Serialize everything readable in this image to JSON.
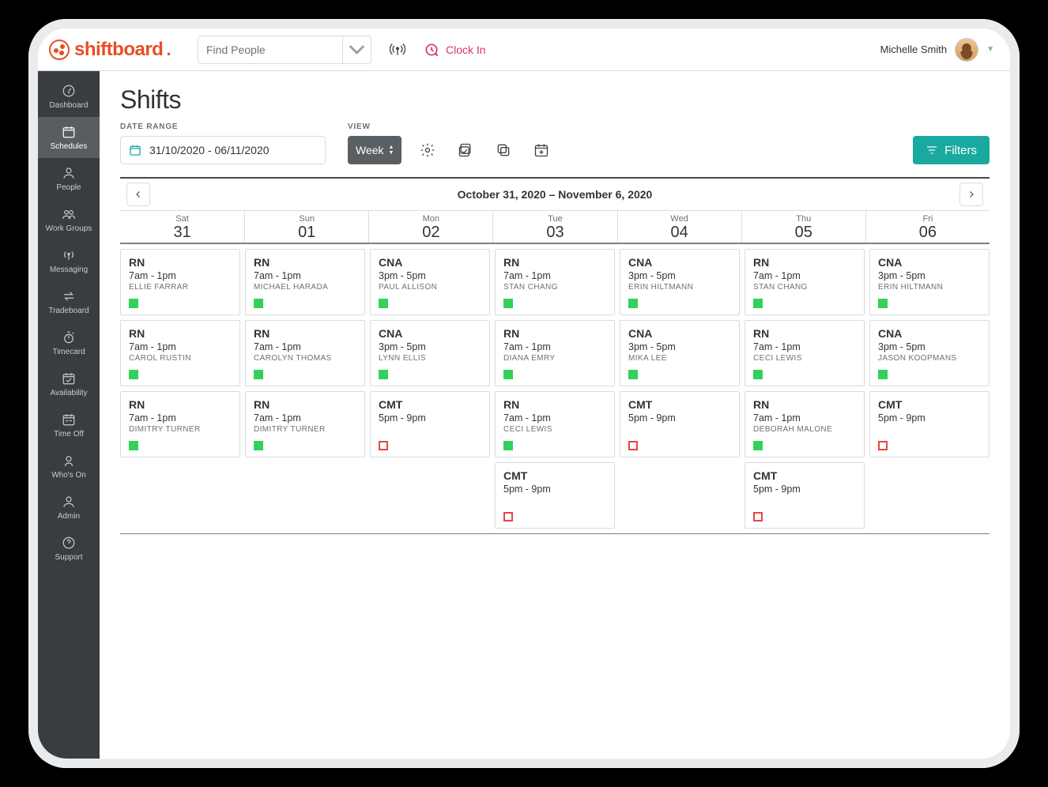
{
  "brand": "shiftboard",
  "find": {
    "selected": "Find People"
  },
  "clock_in": "Clock In",
  "user": {
    "name": "Michelle Smith"
  },
  "sidebar": {
    "items": [
      {
        "label": "Dashboard",
        "icon": "gauge"
      },
      {
        "label": "Schedules",
        "icon": "calendar",
        "active": true
      },
      {
        "label": "People",
        "icon": "person"
      },
      {
        "label": "Work Groups",
        "icon": "people"
      },
      {
        "label": "Messaging",
        "icon": "antenna"
      },
      {
        "label": "Tradeboard",
        "icon": "swap"
      },
      {
        "label": "Timecard",
        "icon": "stopwatch"
      },
      {
        "label": "Availability",
        "icon": "cal-check"
      },
      {
        "label": "Time Off",
        "icon": "cal-range"
      },
      {
        "label": "Who's On",
        "icon": "head"
      },
      {
        "label": "Admin",
        "icon": "person"
      },
      {
        "label": "Support",
        "icon": "help"
      }
    ]
  },
  "page": {
    "title": "Shifts",
    "date_range_label": "DATE RANGE",
    "date_range_value": "31/10/2020 - 06/11/2020",
    "view_label": "VIEW",
    "view_value": "Week",
    "filters_label": "Filters",
    "range_text": "October 31, 2020 – November 6, 2020"
  },
  "days": [
    {
      "dow": "Sat",
      "dom": "31"
    },
    {
      "dow": "Sun",
      "dom": "01"
    },
    {
      "dow": "Mon",
      "dom": "02"
    },
    {
      "dow": "Tue",
      "dom": "03"
    },
    {
      "dow": "Wed",
      "dom": "04"
    },
    {
      "dow": "Thu",
      "dom": "05"
    },
    {
      "dow": "Fri",
      "dom": "06"
    }
  ],
  "shifts": [
    [
      {
        "role": "RN",
        "time": "7am - 1pm",
        "person": "Ellie Farrar",
        "status": "green"
      },
      {
        "role": "RN",
        "time": "7am - 1pm",
        "person": "Carol Rustin",
        "status": "green"
      },
      {
        "role": "RN",
        "time": "7am - 1pm",
        "person": "Dimitry Turner",
        "status": "green"
      }
    ],
    [
      {
        "role": "RN",
        "time": "7am - 1pm",
        "person": "Michael Harada",
        "status": "green"
      },
      {
        "role": "RN",
        "time": "7am - 1pm",
        "person": "Carolyn Thomas",
        "status": "green"
      },
      {
        "role": "RN",
        "time": "7am - 1pm",
        "person": "Dimitry Turner",
        "status": "green"
      }
    ],
    [
      {
        "role": "CNA",
        "time": "3pm - 5pm",
        "person": "Paul Allison",
        "status": "green"
      },
      {
        "role": "CNA",
        "time": "3pm - 5pm",
        "person": "Lynn Ellis",
        "status": "green"
      },
      {
        "role": "CMT",
        "time": "5pm - 9pm",
        "person": "",
        "status": "red"
      }
    ],
    [
      {
        "role": "RN",
        "time": "7am - 1pm",
        "person": "Stan Chang",
        "status": "green"
      },
      {
        "role": "RN",
        "time": "7am - 1pm",
        "person": "Diana Emry",
        "status": "green"
      },
      {
        "role": "RN",
        "time": "7am - 1pm",
        "person": "Ceci Lewis",
        "status": "green"
      },
      {
        "role": "CMT",
        "time": "5pm - 9pm",
        "person": "",
        "status": "red"
      }
    ],
    [
      {
        "role": "CNA",
        "time": "3pm - 5pm",
        "person": "Erin Hiltmann",
        "status": "green"
      },
      {
        "role": "CNA",
        "time": "3pm - 5pm",
        "person": "Mika Lee",
        "status": "green"
      },
      {
        "role": "CMT",
        "time": "5pm - 9pm",
        "person": "",
        "status": "red"
      }
    ],
    [
      {
        "role": "RN",
        "time": "7am - 1pm",
        "person": "Stan Chang",
        "status": "green"
      },
      {
        "role": "RN",
        "time": "7am - 1pm",
        "person": "Ceci Lewis",
        "status": "green"
      },
      {
        "role": "RN",
        "time": "7am - 1pm",
        "person": "Deborah Malone",
        "status": "green"
      },
      {
        "role": "CMT",
        "time": "5pm - 9pm",
        "person": "",
        "status": "red"
      }
    ],
    [
      {
        "role": "CNA",
        "time": "3pm - 5pm",
        "person": "Erin Hiltmann",
        "status": "green"
      },
      {
        "role": "CNA",
        "time": "3pm - 5pm",
        "person": "Jason Koopmans",
        "status": "green"
      },
      {
        "role": "CMT",
        "time": "5pm - 9pm",
        "person": "",
        "status": "red"
      }
    ]
  ]
}
